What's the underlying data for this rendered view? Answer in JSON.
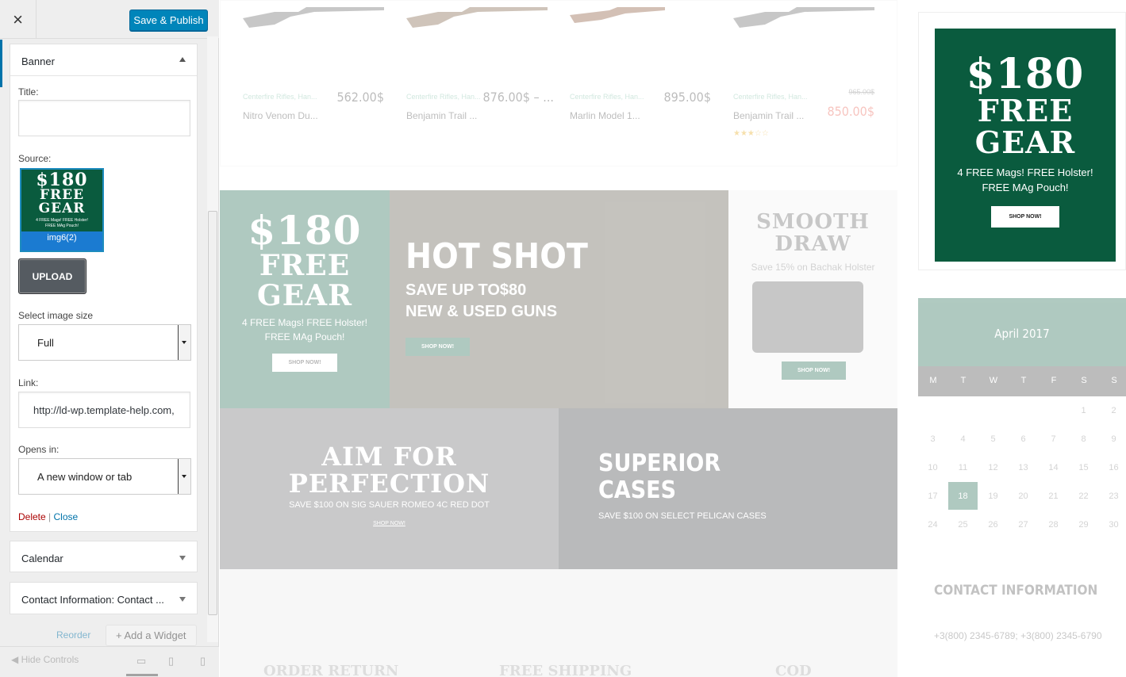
{
  "header": {
    "close_label": "×",
    "publish_label": "Save & Publish"
  },
  "banner_widget": {
    "title": "Banner",
    "title_label": "Title:",
    "title_value": "",
    "source_label": "Source:",
    "thumb_price": "$180",
    "thumb_line1": "FREE",
    "thumb_line2": "GEAR",
    "thumb_small": "4 FREE Mags! FREE Holster!",
    "thumb_small2": "FREE MAg Pouch!",
    "thumb_name": "img6(2)",
    "upload_label": "UPLOAD",
    "size_label": "Select image size",
    "size_value": "Full",
    "link_label": "Link:",
    "link_value": "http://ld-wp.template-help.com,",
    "opens_label": "Opens in:",
    "opens_value": "A new window or tab",
    "delete_label": "Delete",
    "separator": "|",
    "close_label": "Close"
  },
  "calendar_widget": {
    "title": "Calendar"
  },
  "contact_widget": {
    "title": "Contact Information: Contact ..."
  },
  "panel_footer": {
    "reorder_label": "Reorder",
    "add_widget_label": "Add a Widget",
    "hide_controls_label": "Hide Controls"
  },
  "products": [
    {
      "category": "Centerfire Rifles, Han...",
      "price": "562.00$",
      "name": "Nitro Venom Du..."
    },
    {
      "category": "Centerfire Rifles, Han...",
      "price": "876.00$ – ...",
      "name": "Benjamin Trail ..."
    },
    {
      "category": "Centerfire Rifles, Han...",
      "price": "895.00$",
      "name": "Marlin Model 1..."
    },
    {
      "category": "Centerfire Rifles, Han...",
      "old_price": "965.00$",
      "price": "850.00$",
      "name": "Benjamin Trail ...",
      "rating": "★★★☆☆"
    }
  ],
  "banners": {
    "b1": {
      "price": "$180",
      "line1": "FREE",
      "line2": "GEAR",
      "sub1": "4 FREE Mags! FREE Holster!",
      "sub2": "FREE MAg Pouch!",
      "button": "SHOP NOW!"
    },
    "b2": {
      "title": "HOT SHOT",
      "sub1": "SAVE UP TO$80",
      "sub2": "NEW & USED GUNS",
      "button": "SHOP NOW!"
    },
    "b3": {
      "title1": "SMOOTH",
      "title2": "DRAW",
      "sub": "Save 15% on Bachak Holster",
      "button": "SHOP NOW!"
    },
    "b4": {
      "title1": "AIM FOR",
      "title2": "PERFECTION",
      "sub": "SAVE $100 ON SIG SAUER ROMEO 4C RED DOT",
      "button": "SHOP NOW!"
    },
    "b5": {
      "title1": "SUPERIOR",
      "title2": "CASES",
      "sub": "SAVE $100 ON SELECT PELICAN CASES"
    }
  },
  "footer_strip": {
    "f1": "ORDER RETURN",
    "f2": "FREE SHIPPING",
    "f3": "COD"
  },
  "sidebar_ad": {
    "price": "$180",
    "line1": "FREE",
    "line2": "GEAR",
    "sub1": "4 FREE Mags! FREE Holster!",
    "sub2": "FREE MAg Pouch!",
    "button": "SHOP NOW!"
  },
  "calendar": {
    "month": "April 2017",
    "days": [
      "M",
      "T",
      "W",
      "T",
      "F",
      "S",
      "S"
    ],
    "weeks": [
      [
        "",
        "",
        "",
        "",
        "",
        "1",
        "2"
      ],
      [
        "3",
        "4",
        "5",
        "6",
        "7",
        "8",
        "9"
      ],
      [
        "10",
        "11",
        "12",
        "13",
        "14",
        "15",
        "16"
      ],
      [
        "17",
        "18",
        "19",
        "20",
        "21",
        "22",
        "23"
      ],
      [
        "24",
        "25",
        "26",
        "27",
        "28",
        "29",
        "30"
      ]
    ],
    "today": "18"
  },
  "contact": {
    "title": "CONTACT INFORMATION",
    "phone": "+3(800) 2345-6789; +3(800) 2345-6790"
  },
  "colors": {
    "brand_green": "#0a5b3e",
    "wp_blue": "#0085ba",
    "delete_red": "#aa0000",
    "price_red": "#e74c3c"
  }
}
